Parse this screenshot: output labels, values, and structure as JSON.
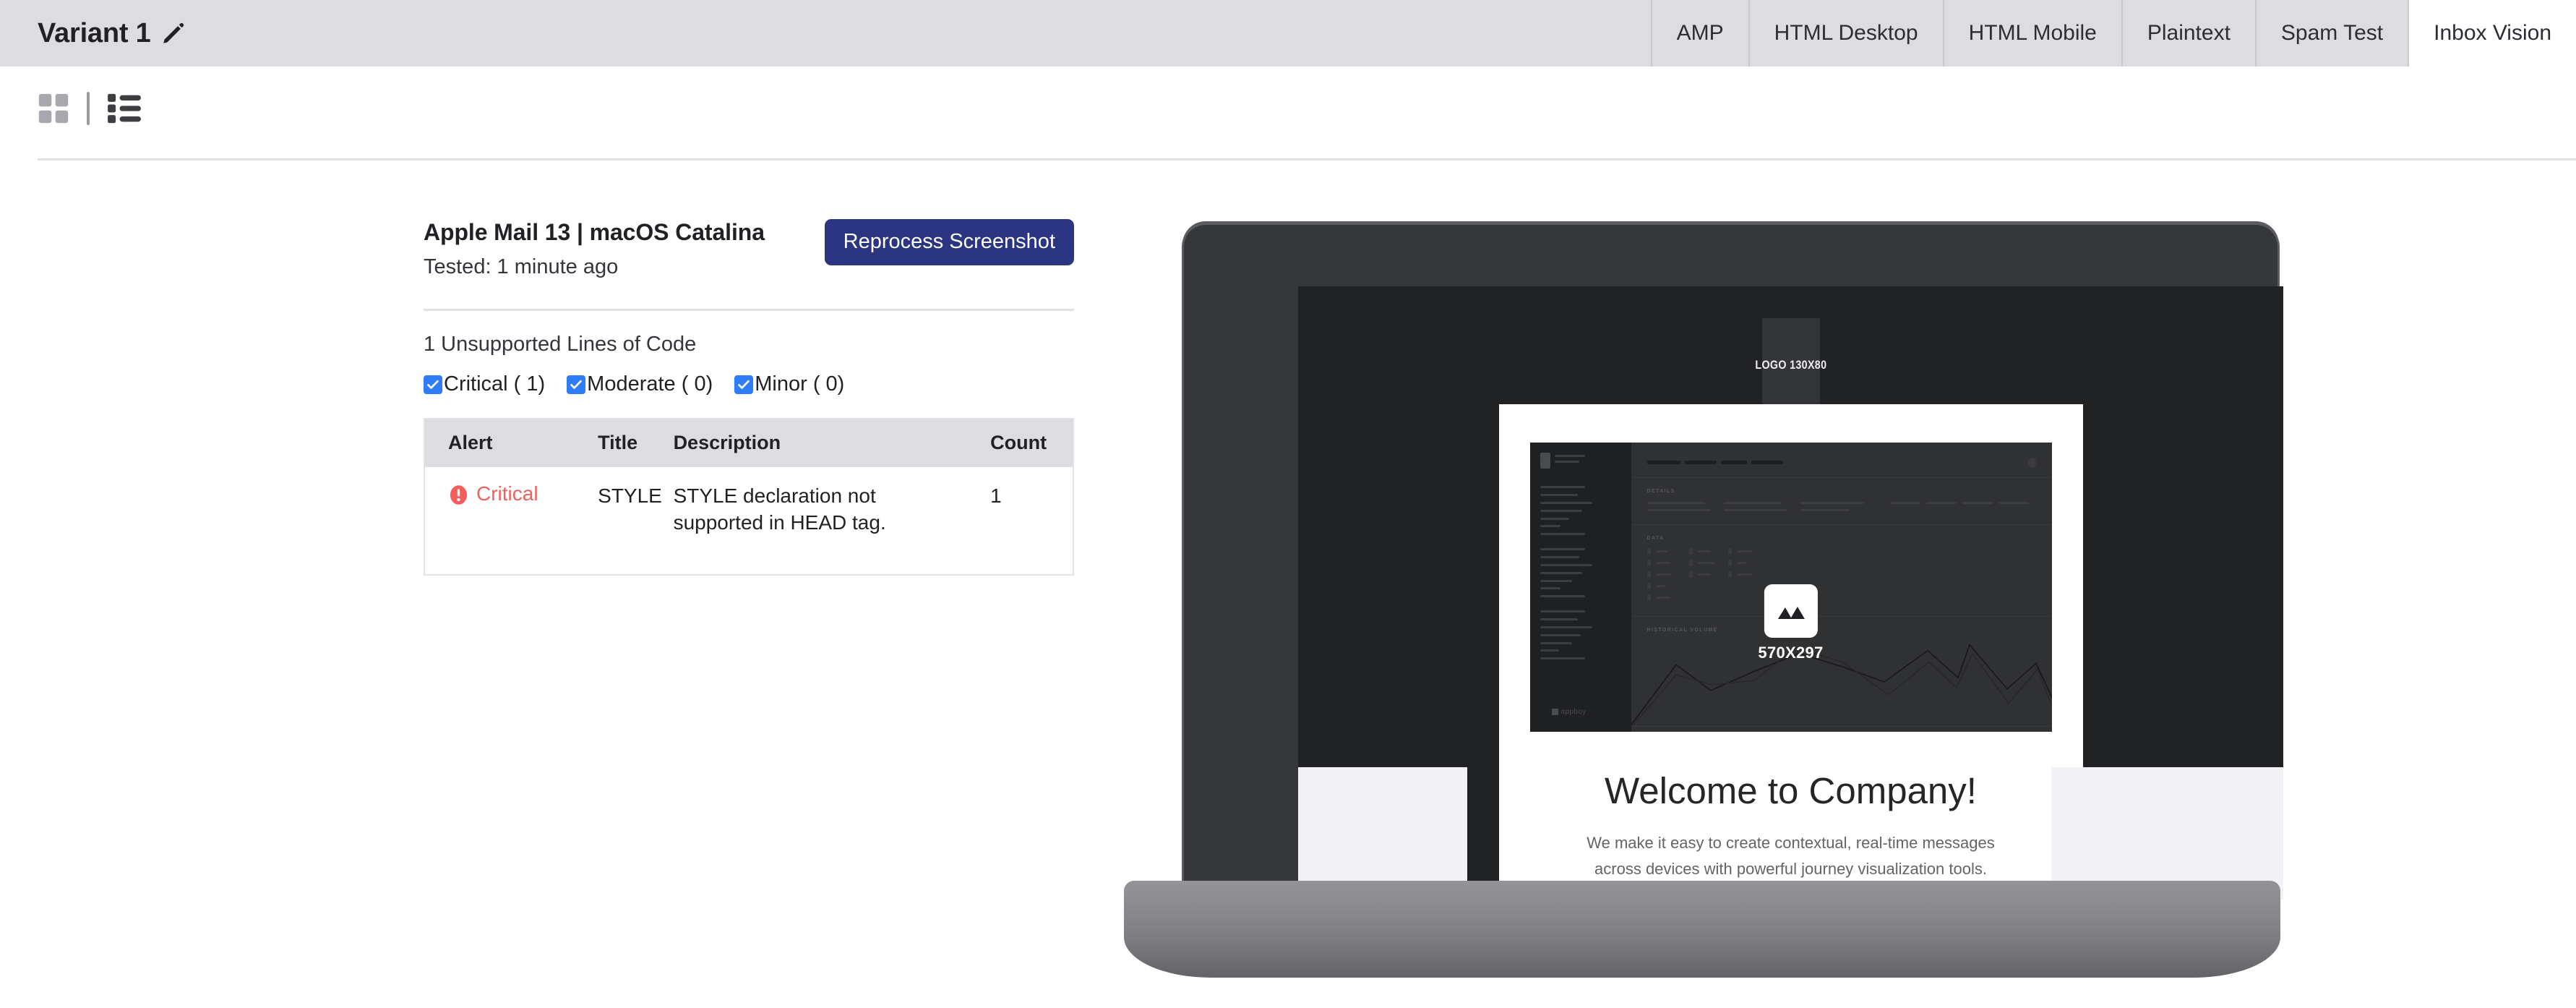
{
  "header": {
    "title": "Variant 1",
    "edit_icon": "pencil-icon",
    "tabs": [
      {
        "label": "AMP",
        "active": false
      },
      {
        "label": "HTML Desktop",
        "active": false
      },
      {
        "label": "HTML Mobile",
        "active": false
      },
      {
        "label": "Plaintext",
        "active": false
      },
      {
        "label": "Spam Test",
        "active": false
      },
      {
        "label": "Inbox Vision",
        "active": true
      }
    ]
  },
  "toolbar": {
    "grid_view_icon": "grid-view-icon",
    "list_view_icon": "list-view-icon"
  },
  "report": {
    "device_title": "Apple Mail 13 | macOS Catalina",
    "tested_label": "Tested: 1 minute ago",
    "reprocess_label": "Reprocess Screenshot",
    "unsupported_summary": "1 Unsupported Lines of Code",
    "severity_filters": [
      {
        "label": "Critical ( 1)",
        "checked": true
      },
      {
        "label": "Moderate ( 0)",
        "checked": true
      },
      {
        "label": "Minor ( 0)",
        "checked": true
      }
    ],
    "table": {
      "columns": [
        "Alert",
        "Title",
        "Description",
        "Count"
      ],
      "rows": [
        {
          "alert": "Critical",
          "alert_icon": "alert-exclamation-icon",
          "alert_color": "#f25f5c",
          "title": "STYLE",
          "description": "STYLE declaration not supported in HEAD tag.",
          "count": "1"
        }
      ]
    }
  },
  "preview": {
    "device_frame": "laptop-mockup",
    "email": {
      "logo_placeholder": "LOGO 130X80",
      "image_placeholder_label": "570X297",
      "image_placeholder_icon": "image-mountain-icon",
      "heading": "Welcome to Company!",
      "body": "We make it easy to create contextual, real-time messages across devices with powerful journey visualization tools.",
      "dashboard_sections": [
        "DETAILS",
        "DATA",
        "HISTORICAL VOLUME"
      ],
      "dashboard_brand": "appboy"
    }
  },
  "colors": {
    "header_bg": "#dcdce1",
    "accent_button": "#2b3582",
    "checkbox": "#2e7cf6",
    "critical": "#f25f5c",
    "divider": "#e2e2e6"
  }
}
